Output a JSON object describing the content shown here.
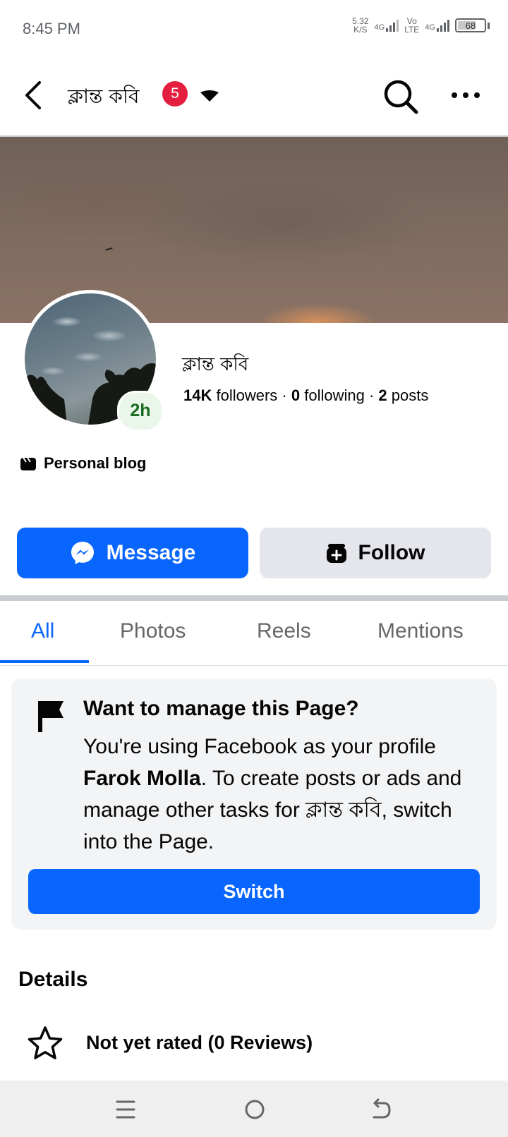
{
  "status_bar": {
    "time": "8:45 PM",
    "net_speed_value": "5.32",
    "net_speed_unit": "K/S",
    "sim1_label": "4G",
    "volte_label_top": "Vo",
    "volte_label_bottom": "LTE",
    "sim2_label": "4G",
    "battery": "68"
  },
  "header": {
    "page_name": "ক্লান্ত কবি",
    "notification_count": "5"
  },
  "profile": {
    "name": "ক্লান্ত কবি",
    "story_time": "2h",
    "followers_count": "14K",
    "followers_label": "followers",
    "following_count": "0",
    "following_label": "following",
    "posts_count": "2",
    "posts_label": "posts",
    "category": "Personal blog"
  },
  "actions": {
    "message_label": "Message",
    "follow_label": "Follow"
  },
  "tabs": [
    {
      "label": "All",
      "active": true
    },
    {
      "label": "Photos",
      "active": false
    },
    {
      "label": "Reels",
      "active": false
    },
    {
      "label": "Mentions",
      "active": false
    }
  ],
  "manage_card": {
    "title": "Want to manage this Page?",
    "body_part1": "You're using Facebook as your profile ",
    "profile_name": "Farok Molla",
    "body_part2": ". To create posts or ads and manage other tasks for ক্লান্ত কবি, switch into the Page.",
    "switch_label": "Switch"
  },
  "details": {
    "title": "Details",
    "rating_text": "Not yet rated (0 Reviews)"
  },
  "colors": {
    "accent": "#0866ff",
    "badge": "#e41e3f",
    "secondary_button": "#e4e6eb"
  }
}
